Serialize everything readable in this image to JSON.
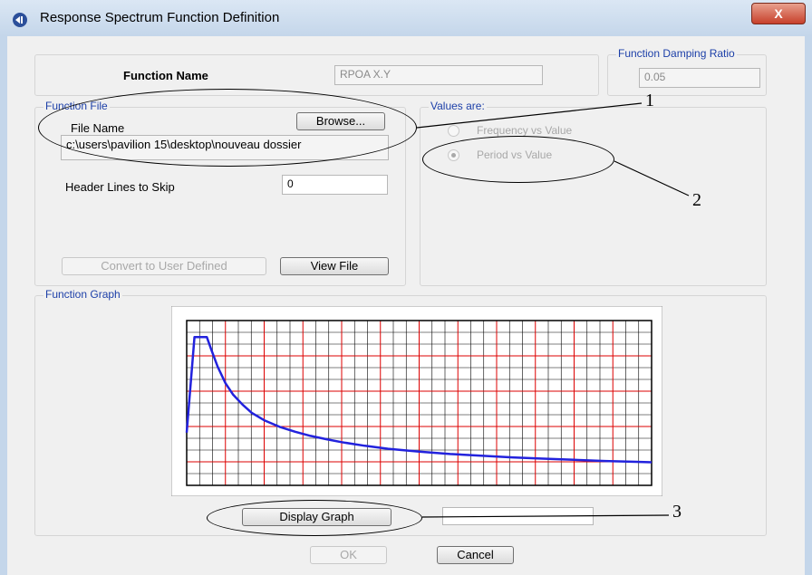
{
  "window": {
    "title": "Response Spectrum  Function Definition",
    "close_label": "X"
  },
  "function_name": {
    "label": "Function Name",
    "value": "RPOA X.Y"
  },
  "damping": {
    "label": "Function Damping Ratio",
    "value": "0.05"
  },
  "function_file": {
    "group_label": "Function File",
    "file_name_label": "File Name",
    "browse_label": "Browse...",
    "path": "c:\\users\\pavilion 15\\desktop\\nouveau dossier",
    "header_lines_label": "Header Lines to Skip",
    "header_lines_value": "0",
    "convert_label": "Convert to User Defined",
    "view_file_label": "View File"
  },
  "values_are": {
    "group_label": "Values are:",
    "options": [
      {
        "label": "Frequency vs Value",
        "selected": false
      },
      {
        "label": "Period vs Value",
        "selected": true
      }
    ]
  },
  "graph": {
    "group_label": "Function Graph",
    "display_label": "Display Graph",
    "line_color": "#2222dd",
    "major_grid_color": "#dd0000",
    "minor_grid_color": "#000000"
  },
  "chart_data": {
    "type": "line",
    "series": [
      {
        "values": [
          [
            0.0,
            0.32
          ],
          [
            0.05,
            0.9
          ],
          [
            0.13,
            0.9
          ],
          [
            0.16,
            0.82
          ],
          [
            0.2,
            0.72
          ],
          [
            0.25,
            0.62
          ],
          [
            0.3,
            0.55
          ],
          [
            0.36,
            0.49
          ],
          [
            0.42,
            0.44
          ],
          [
            0.5,
            0.395
          ],
          [
            0.6,
            0.355
          ],
          [
            0.7,
            0.325
          ],
          [
            0.8,
            0.3
          ],
          [
            0.9,
            0.28
          ],
          [
            1.0,
            0.262
          ],
          [
            1.15,
            0.24
          ],
          [
            1.3,
            0.222
          ],
          [
            1.5,
            0.205
          ],
          [
            1.7,
            0.19
          ],
          [
            1.9,
            0.18
          ],
          [
            2.1,
            0.17
          ],
          [
            2.3,
            0.162
          ],
          [
            2.5,
            0.155
          ],
          [
            2.7,
            0.148
          ],
          [
            2.9,
            0.143
          ],
          [
            3.0,
            0.14
          ]
        ]
      }
    ],
    "xlim": [
      0,
      3
    ],
    "ylim": [
      0,
      1
    ],
    "grid": true
  },
  "callouts": [
    "1",
    "2",
    "3"
  ],
  "footer": {
    "ok_label": "OK",
    "cancel_label": "Cancel"
  }
}
